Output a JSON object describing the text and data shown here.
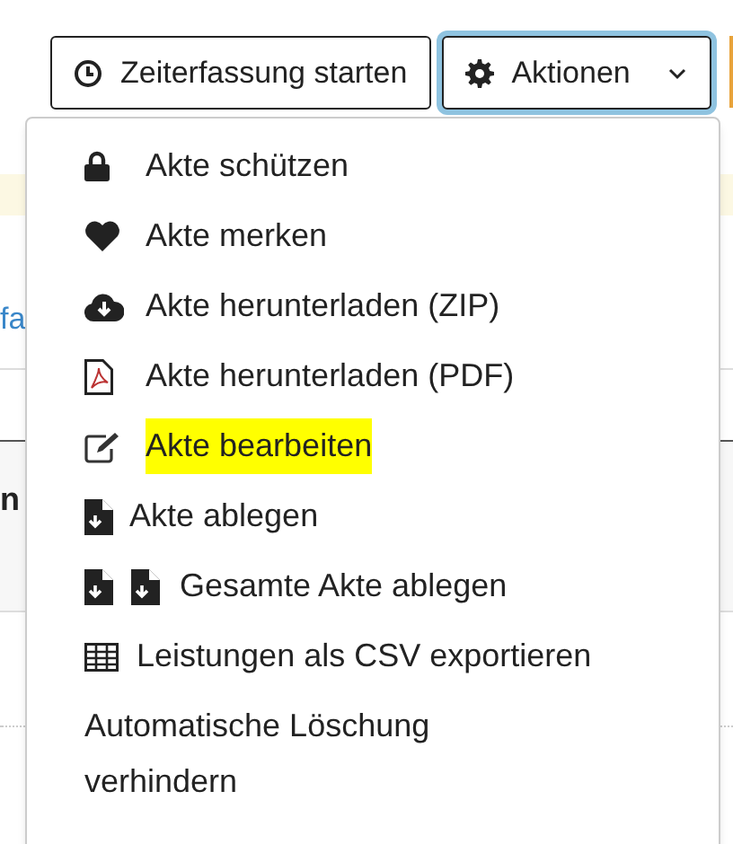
{
  "toolbar": {
    "buttons": [
      {
        "label": "Zeiterfassung starten",
        "focused": false
      },
      {
        "label": "Aktionen",
        "focused": true
      }
    ]
  },
  "page_behind": {
    "link_fragment": "fa",
    "heading_fragment": "n"
  },
  "menu": {
    "items": [
      {
        "label": "Akte schützen",
        "highlighted": false
      },
      {
        "label": "Akte merken",
        "highlighted": false
      },
      {
        "label": "Akte herunterladen (ZIP)",
        "highlighted": false
      },
      {
        "label": "Akte herunterladen (PDF)",
        "highlighted": false
      },
      {
        "label": "Akte bearbeiten",
        "highlighted": true
      },
      {
        "label": "Akte ablegen",
        "highlighted": false
      },
      {
        "label": "Gesamte Akte ablegen",
        "highlighted": false
      },
      {
        "label": "Leistungen als CSV exportieren",
        "highlighted": false
      },
      {
        "label": "Automatische Löschung verhindern",
        "highlighted": false
      }
    ]
  }
}
